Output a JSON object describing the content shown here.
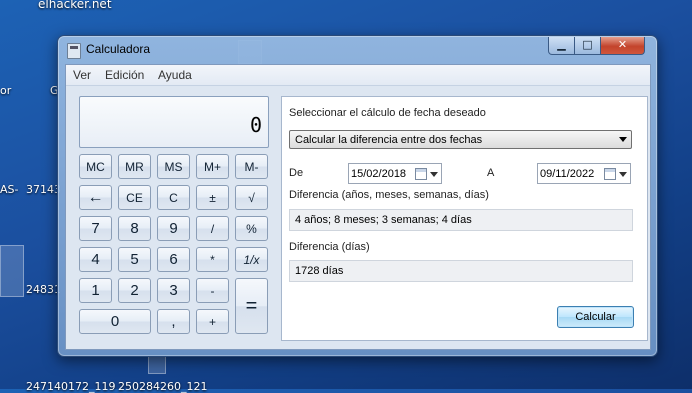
{
  "desktop": {
    "labels": [
      "elhacker.net",
      "or",
      "G",
      "AS-",
      "37143",
      "24831",
      "247140172_119",
      "250284260_121"
    ]
  },
  "window": {
    "title": "Calculadora",
    "icon": "calculator-icon",
    "controls": {
      "minimize": "minimize-icon",
      "maximize": "maximize-icon",
      "close": "close-icon"
    }
  },
  "menu": {
    "items": [
      "Ver",
      "Edición",
      "Ayuda"
    ]
  },
  "calculator": {
    "display": "0",
    "keys": [
      [
        "MC",
        "MR",
        "MS",
        "M+",
        "M-"
      ],
      [
        "←",
        "CE",
        "C",
        "±",
        "√"
      ],
      [
        "7",
        "8",
        "9",
        "/",
        "%"
      ],
      [
        "4",
        "5",
        "6",
        "*",
        "1/x"
      ],
      [
        "1",
        "2",
        "3",
        "-",
        "="
      ],
      [
        "0",
        ",",
        "+"
      ]
    ]
  },
  "date_panel": {
    "heading": "Seleccionar el cálculo de fecha deseado",
    "mode": "Calcular la diferencia entre dos fechas",
    "from_label": "De",
    "from_date": "15/02/2018",
    "to_label": "A",
    "to_date": "09/11/2022",
    "diff_label": "Diferencia (años, meses, semanas, días)",
    "diff_value": "4 años; 8 meses; 3 semanas; 4 días",
    "days_label": "Diferencia (días)",
    "days_value": "1728 días",
    "button": "Calcular"
  }
}
